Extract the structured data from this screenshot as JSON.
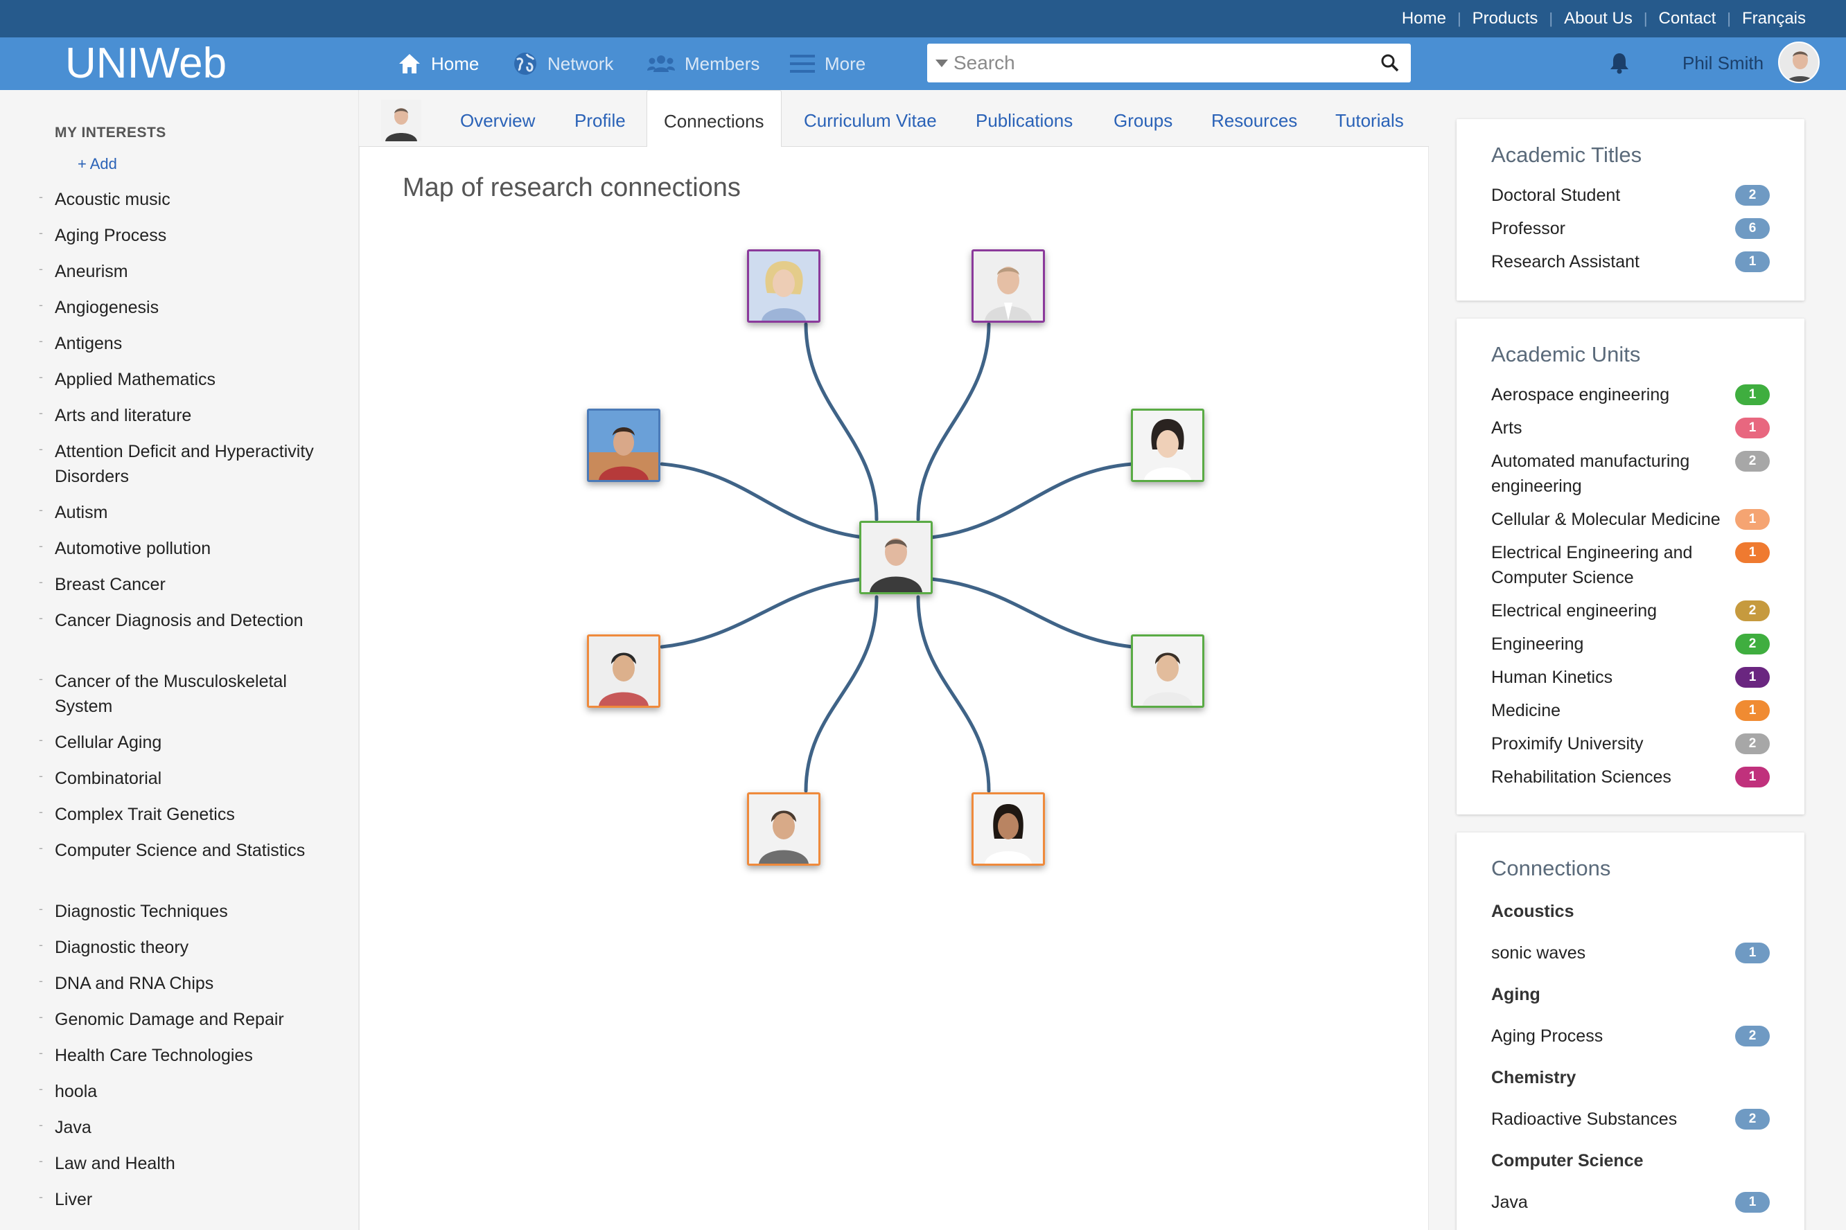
{
  "topbar": {
    "links": [
      "Home",
      "Products",
      "About Us",
      "Contact",
      "Français"
    ]
  },
  "navbar": {
    "logo": "UNIWeb",
    "home": "Home",
    "network": "Network",
    "members": "Members",
    "more": "More",
    "search_placeholder": "Search",
    "user_name": "Phil Smith"
  },
  "sidebar": {
    "heading": "MY INTERESTS",
    "add_label": "+ Add",
    "interests": [
      "Acoustic music",
      "Aging Process",
      "Aneurism",
      "Angiogenesis",
      "Antigens",
      "Applied Mathematics",
      "Arts and literature",
      "Attention Deficit and Hyperactivity Disorders",
      "Autism",
      "Automotive pollution",
      "Breast Cancer",
      "Cancer Diagnosis and Detection",
      "Cancer of the Musculoskeletal System",
      "Cellular Aging",
      "Combinatorial",
      "Complex Trait Genetics",
      "Computer Science and Statistics",
      "Diagnostic Techniques",
      "Diagnostic theory",
      "DNA and RNA Chips",
      "Genomic Damage and Repair",
      "Health Care Technologies",
      "hoola",
      "Java",
      "Law and Health",
      "Liver"
    ]
  },
  "tabs": [
    "Overview",
    "Profile",
    "Connections",
    "Curriculum Vitae",
    "Publications",
    "Groups",
    "Resources",
    "Tutorials"
  ],
  "active_tab": "Connections",
  "main": {
    "title": "Map of research connections"
  },
  "colors": {
    "topbar": "#265a8c",
    "navbar": "#4a8fd3",
    "link": "#2a62b7",
    "connector": "#3f6387",
    "border_green": "#5aab45",
    "border_purple": "#8b3a9b",
    "border_orange": "#ef8a3c"
  },
  "academic_titles": {
    "title": "Academic Titles",
    "items": [
      {
        "label": "Doctoral Student",
        "count": "2",
        "color": "#6f9ac3"
      },
      {
        "label": "Professor",
        "count": "6",
        "color": "#6f9ac3"
      },
      {
        "label": "Research Assistant",
        "count": "1",
        "color": "#6f9ac3"
      }
    ]
  },
  "academic_units": {
    "title": "Academic Units",
    "items": [
      {
        "label": "Aerospace engineering",
        "count": "1",
        "color": "#3fae3f"
      },
      {
        "label": "Arts",
        "count": "1",
        "color": "#e8677f"
      },
      {
        "label": "Automated manufacturing engineering",
        "count": "2",
        "color": "#a7a7a7"
      },
      {
        "label": "Cellular & Molecular Medicine",
        "count": "1",
        "color": "#f5a472"
      },
      {
        "label": "Electrical Engineering and Computer Science",
        "count": "1",
        "color": "#ef7a30"
      },
      {
        "label": "Electrical engineering",
        "count": "2",
        "color": "#c69a3e"
      },
      {
        "label": "Engineering",
        "count": "2",
        "color": "#3fae3f"
      },
      {
        "label": "Human Kinetics",
        "count": "1",
        "color": "#6a2680"
      },
      {
        "label": "Medicine",
        "count": "1",
        "color": "#f08b32"
      },
      {
        "label": "Proximify University",
        "count": "2",
        "color": "#a7a7a7"
      },
      {
        "label": "Rehabilitation Sciences",
        "count": "1",
        "color": "#c0317c"
      }
    ]
  },
  "connections": {
    "title": "Connections",
    "groups": [
      {
        "category": "Acoustics",
        "item": "sonic waves",
        "count": "1"
      },
      {
        "category": "Aging",
        "item": "Aging Process",
        "count": "2"
      },
      {
        "category": "Chemistry",
        "item": "Radioactive Substances",
        "count": "2"
      },
      {
        "category": "Computer Science",
        "item": "Java",
        "count": "1"
      }
    ],
    "badge_color": "#6f9ac3"
  }
}
